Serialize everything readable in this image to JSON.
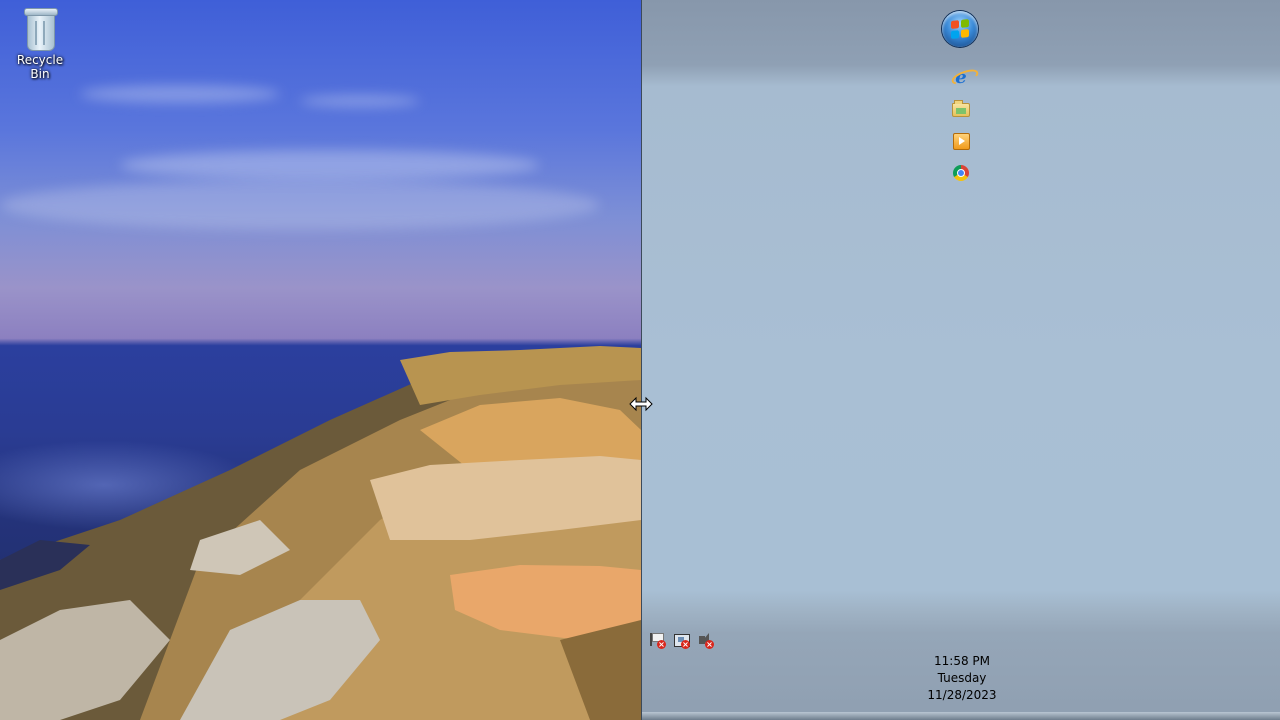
{
  "desktop": {
    "icons": [
      {
        "label": "Recycle Bin",
        "icon": "recycle-bin-icon"
      }
    ]
  },
  "taskbar": {
    "start_button": {
      "icon": "windows-start-orb-icon"
    },
    "pinned": [
      {
        "icon": "internet-explorer-icon"
      },
      {
        "icon": "windows-explorer-folder-icon"
      },
      {
        "icon": "windows-media-player-icon"
      },
      {
        "icon": "google-chrome-icon"
      }
    ],
    "tray": [
      {
        "icon": "action-center-icon",
        "status": "error"
      },
      {
        "icon": "network-icon",
        "status": "error"
      },
      {
        "icon": "volume-muted-icon",
        "status": "error"
      }
    ],
    "clock": {
      "time": "11:58 PM",
      "day": "Tuesday",
      "date": "11/28/2023"
    }
  },
  "cursor": {
    "type": "horizontal-resize-cursor"
  },
  "colors": {
    "taskbar_bg": "#a9bfd4",
    "start_orb_blue": "#3a8ad8",
    "flag_red": "#f25022",
    "flag_green": "#7fba00",
    "flag_blue": "#00a4ef",
    "flag_yellow": "#ffb900",
    "error_red": "#d9261c"
  }
}
